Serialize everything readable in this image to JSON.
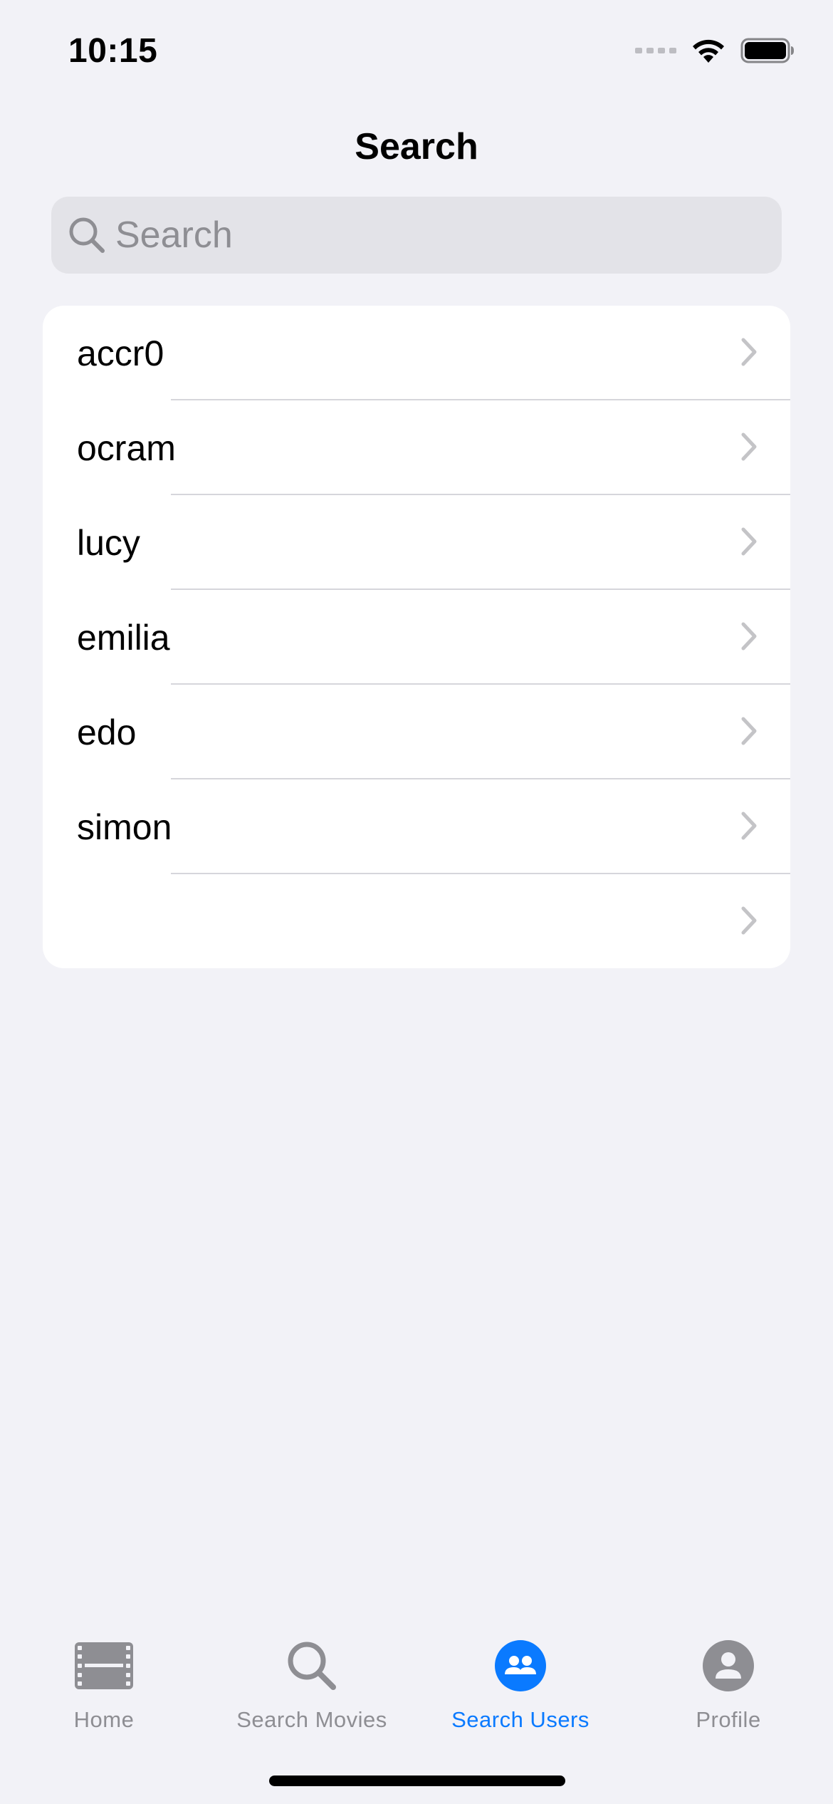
{
  "status_bar": {
    "time": "10:15",
    "signal_icon": "cellular-signal-icon",
    "wifi_icon": "wifi-icon",
    "battery_icon": "battery-icon"
  },
  "header": {
    "title": "Search"
  },
  "search": {
    "placeholder": "Search",
    "value": "",
    "icon": "search-icon"
  },
  "users": [
    {
      "label": "accr0"
    },
    {
      "label": "ocram"
    },
    {
      "label": "lucy"
    },
    {
      "label": "emilia"
    },
    {
      "label": "edo"
    },
    {
      "label": "simon"
    },
    {
      "label": ""
    }
  ],
  "tab_bar": {
    "tabs": [
      {
        "label": "Home",
        "icon": "film-icon",
        "active": false
      },
      {
        "label": "Search Movies",
        "icon": "magnifier-icon",
        "active": false
      },
      {
        "label": "Search Users",
        "icon": "users-icon",
        "active": true
      },
      {
        "label": "Profile",
        "icon": "person-icon",
        "active": false
      }
    ]
  },
  "colors": {
    "accent": "#0A7AFF",
    "inactive": "#8E8E93",
    "background": "#F2F2F7",
    "card": "#FFFFFF"
  }
}
